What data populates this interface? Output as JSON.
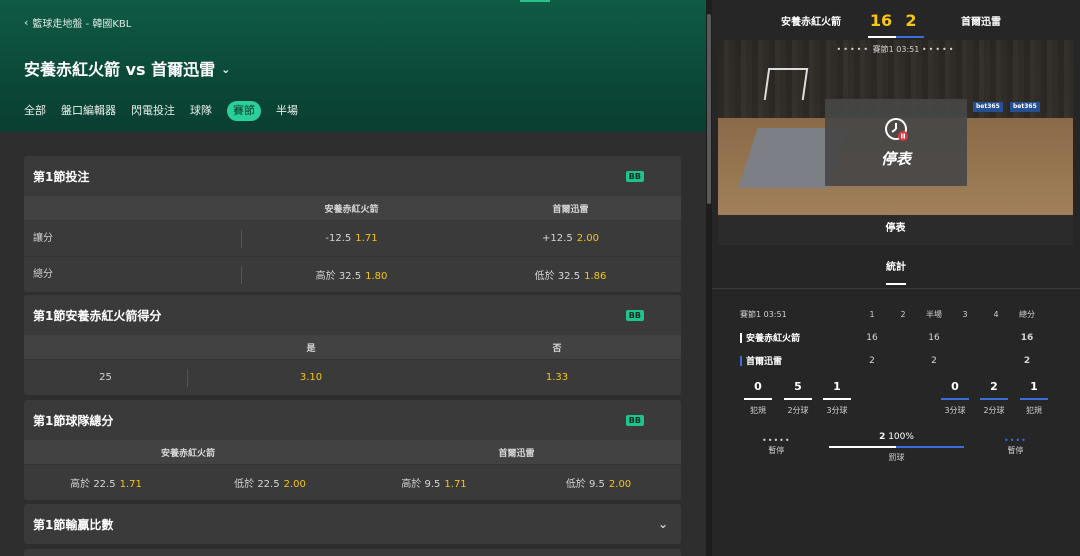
{
  "breadcrumb": "籃球走地盤 - 韓國KBL",
  "match_title": "安養赤紅火箭 vs 首爾迅雷",
  "tabs": [
    "全部",
    "盤口編輯器",
    "閃電投注",
    "球隊",
    "賽節",
    "半場"
  ],
  "active_tab_index": 4,
  "cards": {
    "q1_bets": {
      "title": "第1節投注",
      "badge": "BB",
      "col1": "安養赤紅火箭",
      "col2": "首爾迅雷",
      "rows": [
        {
          "label": "讓分",
          "a_line": "-12.5",
          "a_odds": "1.71",
          "b_line": "+12.5",
          "b_odds": "2.00"
        },
        {
          "label": "總分",
          "a_line": "高於 32.5",
          "a_odds": "1.80",
          "b_line": "低於 32.5",
          "b_odds": "1.86"
        }
      ]
    },
    "q1_team_score": {
      "title": "第1節安養赤紅火箭得分",
      "badge": "BB",
      "col_yes": "是",
      "col_no": "否",
      "line": "25",
      "yes_odds": "3.10",
      "no_odds": "1.33"
    },
    "q1_team_total": {
      "title": "第1節球隊總分",
      "badge": "BB",
      "team1": "安養赤紅火箭",
      "team2": "首爾迅雷",
      "cells": [
        {
          "line": "高於 22.5",
          "odds": "1.71"
        },
        {
          "line": "低於 22.5",
          "odds": "2.00"
        },
        {
          "line": "高於 9.5",
          "odds": "1.71"
        },
        {
          "line": "低於 9.5",
          "odds": "2.00"
        }
      ]
    },
    "q1_margin": {
      "title": "第1節輸贏比數"
    }
  },
  "scoreboard": {
    "home": "安養赤紅火箭",
    "away": "首爾迅雷",
    "home_score": "16",
    "away_score": "2",
    "period_text": "賽節1 03:51",
    "status_big": "停表",
    "status_label": "停表",
    "court_banners": [
      "bet365",
      "bet365"
    ],
    "colors": {
      "home": "#ffffff",
      "away": "#3a6fd8",
      "score": "#f5c518"
    }
  },
  "stats": {
    "tab_label": "統計",
    "header": {
      "period": "賽節1 03:51",
      "cols": [
        "1",
        "2",
        "半場",
        "3",
        "4",
        "總分"
      ]
    },
    "rows": [
      {
        "team": "安養赤紅火箭",
        "vals": [
          "16",
          "",
          "16",
          "",
          "",
          "16"
        ]
      },
      {
        "team": "首爾迅雷",
        "vals": [
          "2",
          "",
          "2",
          "",
          "",
          "2"
        ]
      }
    ],
    "home_stats": [
      {
        "v": "0",
        "l": "犯規"
      },
      {
        "v": "5",
        "l": "2分球"
      },
      {
        "v": "1",
        "l": "3分球"
      }
    ],
    "away_stats": [
      {
        "v": "0",
        "l": "3分球"
      },
      {
        "v": "2",
        "l": "2分球"
      },
      {
        "v": "1",
        "l": "犯規"
      }
    ],
    "home_timeouts_dots": "•••••",
    "away_timeouts_dots": "••••",
    "timeout_label": "暫停",
    "possession_value": "2",
    "possession_pct": "100%",
    "possession_label": "罰球"
  }
}
